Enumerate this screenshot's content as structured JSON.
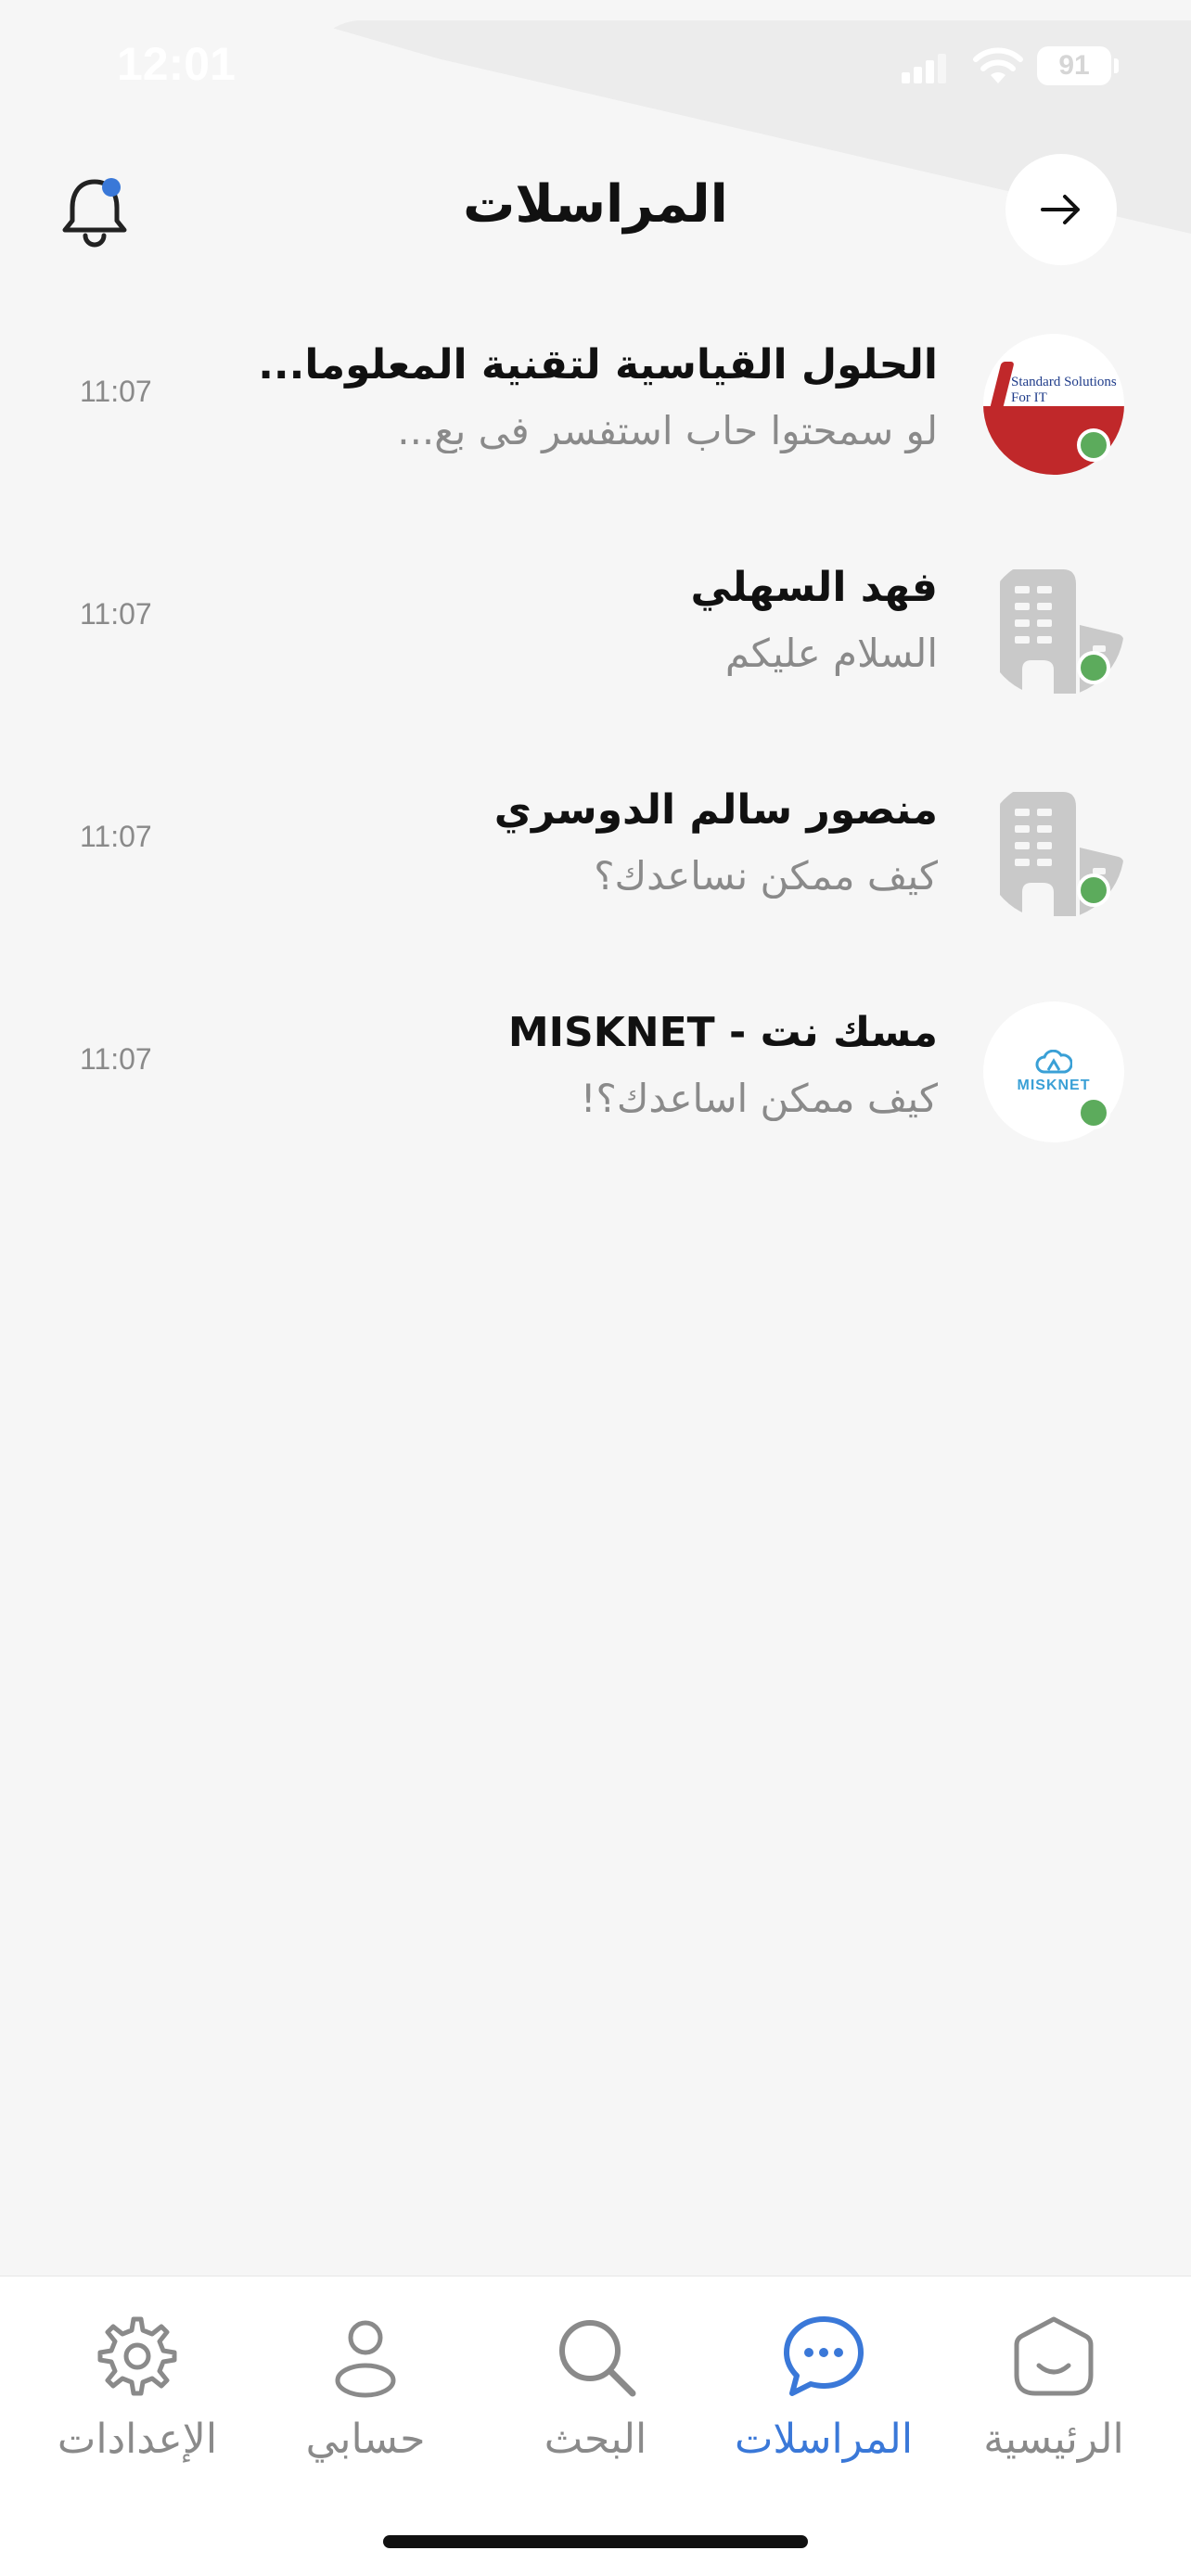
{
  "status_bar": {
    "time": "12:01",
    "battery": "91"
  },
  "header": {
    "title": "المراسلات"
  },
  "conversations": [
    {
      "name": "الحلول القياسية لتقنية المعلوما...",
      "message": "لو سمحتوا حاب استفسر فى بع...",
      "time": "11:07",
      "avatar": "standard-solutions-logo",
      "logo_text": "Standard Solutions For IT"
    },
    {
      "name": "فهد السهلي",
      "message": "السلام عليكم",
      "time": "11:07",
      "avatar": "building-icon"
    },
    {
      "name": "منصور سالم الدوسري",
      "message": "كيف ممكن نساعدك؟",
      "time": "11:07",
      "avatar": "building-icon"
    },
    {
      "name": "مسك نت - MISKNET",
      "message": "كيف ممكن اساعدك؟!",
      "time": "11:07",
      "avatar": "misknet-logo",
      "logo_text": "MISKNET"
    }
  ],
  "bottom_nav": [
    {
      "label": "الإعدادات",
      "icon": "gear-icon",
      "active": false
    },
    {
      "label": "حسابي",
      "icon": "user-icon",
      "active": false
    },
    {
      "label": "البحث",
      "icon": "search-icon",
      "active": false
    },
    {
      "label": "المراسلات",
      "icon": "chat-icon",
      "active": true
    },
    {
      "label": "الرئيسية",
      "icon": "home-icon",
      "active": false
    }
  ],
  "colors": {
    "accent": "#3a78d8",
    "online": "#5cab5c",
    "muted": "#8a8a8a",
    "background": "#f6f6f6"
  }
}
